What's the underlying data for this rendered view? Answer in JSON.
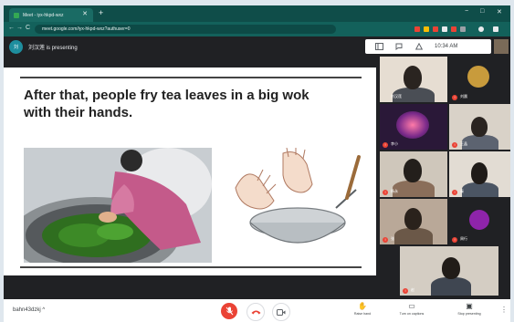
{
  "browser": {
    "tab_title": "Meet - iyx-hkpd-wxz",
    "new_tab": "+",
    "minimize": "−",
    "maximize": "□",
    "close": "✕",
    "back": "←",
    "forward": "→",
    "reload": "C",
    "url": "meet.google.com/iyx-hkpd-wxz?authuser=0"
  },
  "meet": {
    "presenter_initials": "刘",
    "presenter_text": "刘汉莲 is presenting",
    "time": "10:34 AM",
    "meeting_code": "bahn43dzkj",
    "code_chevron": "^"
  },
  "slide": {
    "title_line1": "After that, people fry tea leaves in a big wok",
    "title_line2": "with their hands."
  },
  "tiles": [
    {
      "name": "刘汉莲"
    },
    {
      "name": "刘晨"
    },
    {
      "name": "李小"
    },
    {
      "name": "王晶"
    },
    {
      "name": "杨永"
    },
    {
      "name": "秦"
    },
    {
      "name": "张"
    },
    {
      "name": "周行"
    },
    {
      "name": "赵"
    }
  ],
  "bottom": {
    "raise_hand_label": "Raise hand",
    "captions_label": "Turn on captions",
    "present_label": "Stop presenting",
    "more": "⋮"
  },
  "colors": {
    "accent_teal": "#13615b",
    "mute_red": "#ea4335"
  },
  "icons": {
    "mic": "microphone-off-icon",
    "hangup": "hangup-icon",
    "camera": "camera-icon"
  }
}
